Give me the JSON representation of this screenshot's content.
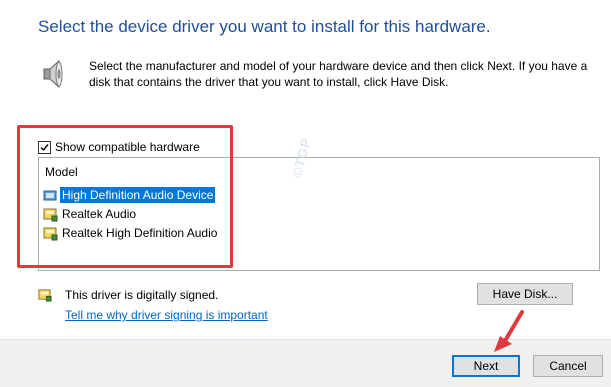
{
  "header": {
    "title": "Select the device driver you want to install for this hardware.",
    "description": "Select the manufacturer and model of your hardware device and then click Next. If you have a disk that contains the driver that you want to install, click Have Disk."
  },
  "compatible": {
    "label": "Show compatible hardware",
    "checked": true
  },
  "model_list": {
    "header": "Model",
    "items": [
      {
        "label": "High Definition Audio Device",
        "selected": true
      },
      {
        "label": "Realtek Audio",
        "selected": false
      },
      {
        "label": "Realtek High Definition Audio",
        "selected": false
      }
    ]
  },
  "watermark": "©TGP",
  "signing": {
    "status": "This driver is digitally signed.",
    "link": "Tell me why driver signing is important"
  },
  "buttons": {
    "have_disk": "Have Disk...",
    "next": "Next",
    "cancel": "Cancel"
  },
  "colors": {
    "title": "#1f4e9c",
    "selection": "#0078d7",
    "highlight_box": "#e0393e",
    "link": "#0066cc"
  }
}
